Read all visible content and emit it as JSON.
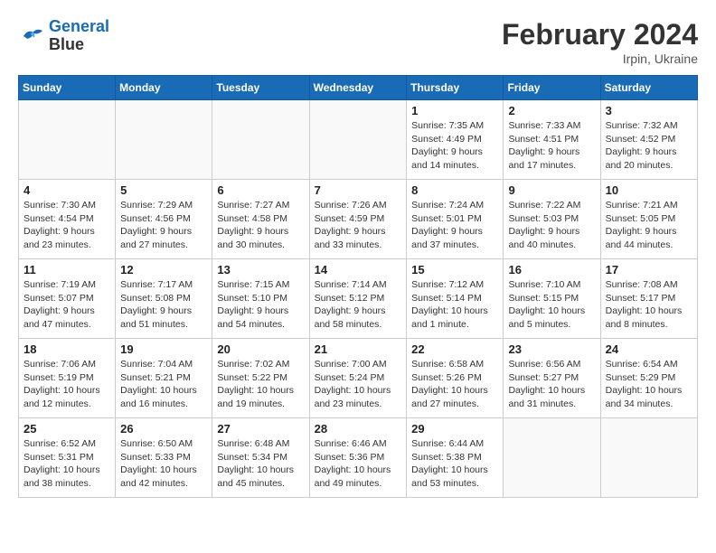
{
  "header": {
    "logo_line1": "General",
    "logo_line2": "Blue",
    "month_year": "February 2024",
    "location": "Irpin, Ukraine"
  },
  "weekdays": [
    "Sunday",
    "Monday",
    "Tuesday",
    "Wednesday",
    "Thursday",
    "Friday",
    "Saturday"
  ],
  "weeks": [
    [
      {
        "day": "",
        "info": "",
        "empty": true
      },
      {
        "day": "",
        "info": "",
        "empty": true
      },
      {
        "day": "",
        "info": "",
        "empty": true
      },
      {
        "day": "",
        "info": "",
        "empty": true
      },
      {
        "day": "1",
        "info": "Sunrise: 7:35 AM\nSunset: 4:49 PM\nDaylight: 9 hours\nand 14 minutes."
      },
      {
        "day": "2",
        "info": "Sunrise: 7:33 AM\nSunset: 4:51 PM\nDaylight: 9 hours\nand 17 minutes."
      },
      {
        "day": "3",
        "info": "Sunrise: 7:32 AM\nSunset: 4:52 PM\nDaylight: 9 hours\nand 20 minutes."
      }
    ],
    [
      {
        "day": "4",
        "info": "Sunrise: 7:30 AM\nSunset: 4:54 PM\nDaylight: 9 hours\nand 23 minutes."
      },
      {
        "day": "5",
        "info": "Sunrise: 7:29 AM\nSunset: 4:56 PM\nDaylight: 9 hours\nand 27 minutes."
      },
      {
        "day": "6",
        "info": "Sunrise: 7:27 AM\nSunset: 4:58 PM\nDaylight: 9 hours\nand 30 minutes."
      },
      {
        "day": "7",
        "info": "Sunrise: 7:26 AM\nSunset: 4:59 PM\nDaylight: 9 hours\nand 33 minutes."
      },
      {
        "day": "8",
        "info": "Sunrise: 7:24 AM\nSunset: 5:01 PM\nDaylight: 9 hours\nand 37 minutes."
      },
      {
        "day": "9",
        "info": "Sunrise: 7:22 AM\nSunset: 5:03 PM\nDaylight: 9 hours\nand 40 minutes."
      },
      {
        "day": "10",
        "info": "Sunrise: 7:21 AM\nSunset: 5:05 PM\nDaylight: 9 hours\nand 44 minutes."
      }
    ],
    [
      {
        "day": "11",
        "info": "Sunrise: 7:19 AM\nSunset: 5:07 PM\nDaylight: 9 hours\nand 47 minutes."
      },
      {
        "day": "12",
        "info": "Sunrise: 7:17 AM\nSunset: 5:08 PM\nDaylight: 9 hours\nand 51 minutes."
      },
      {
        "day": "13",
        "info": "Sunrise: 7:15 AM\nSunset: 5:10 PM\nDaylight: 9 hours\nand 54 minutes."
      },
      {
        "day": "14",
        "info": "Sunrise: 7:14 AM\nSunset: 5:12 PM\nDaylight: 9 hours\nand 58 minutes."
      },
      {
        "day": "15",
        "info": "Sunrise: 7:12 AM\nSunset: 5:14 PM\nDaylight: 10 hours\nand 1 minute."
      },
      {
        "day": "16",
        "info": "Sunrise: 7:10 AM\nSunset: 5:15 PM\nDaylight: 10 hours\nand 5 minutes."
      },
      {
        "day": "17",
        "info": "Sunrise: 7:08 AM\nSunset: 5:17 PM\nDaylight: 10 hours\nand 8 minutes."
      }
    ],
    [
      {
        "day": "18",
        "info": "Sunrise: 7:06 AM\nSunset: 5:19 PM\nDaylight: 10 hours\nand 12 minutes."
      },
      {
        "day": "19",
        "info": "Sunrise: 7:04 AM\nSunset: 5:21 PM\nDaylight: 10 hours\nand 16 minutes."
      },
      {
        "day": "20",
        "info": "Sunrise: 7:02 AM\nSunset: 5:22 PM\nDaylight: 10 hours\nand 19 minutes."
      },
      {
        "day": "21",
        "info": "Sunrise: 7:00 AM\nSunset: 5:24 PM\nDaylight: 10 hours\nand 23 minutes."
      },
      {
        "day": "22",
        "info": "Sunrise: 6:58 AM\nSunset: 5:26 PM\nDaylight: 10 hours\nand 27 minutes."
      },
      {
        "day": "23",
        "info": "Sunrise: 6:56 AM\nSunset: 5:27 PM\nDaylight: 10 hours\nand 31 minutes."
      },
      {
        "day": "24",
        "info": "Sunrise: 6:54 AM\nSunset: 5:29 PM\nDaylight: 10 hours\nand 34 minutes."
      }
    ],
    [
      {
        "day": "25",
        "info": "Sunrise: 6:52 AM\nSunset: 5:31 PM\nDaylight: 10 hours\nand 38 minutes."
      },
      {
        "day": "26",
        "info": "Sunrise: 6:50 AM\nSunset: 5:33 PM\nDaylight: 10 hours\nand 42 minutes."
      },
      {
        "day": "27",
        "info": "Sunrise: 6:48 AM\nSunset: 5:34 PM\nDaylight: 10 hours\nand 45 minutes."
      },
      {
        "day": "28",
        "info": "Sunrise: 6:46 AM\nSunset: 5:36 PM\nDaylight: 10 hours\nand 49 minutes."
      },
      {
        "day": "29",
        "info": "Sunrise: 6:44 AM\nSunset: 5:38 PM\nDaylight: 10 hours\nand 53 minutes."
      },
      {
        "day": "",
        "info": "",
        "empty": true
      },
      {
        "day": "",
        "info": "",
        "empty": true
      }
    ]
  ]
}
